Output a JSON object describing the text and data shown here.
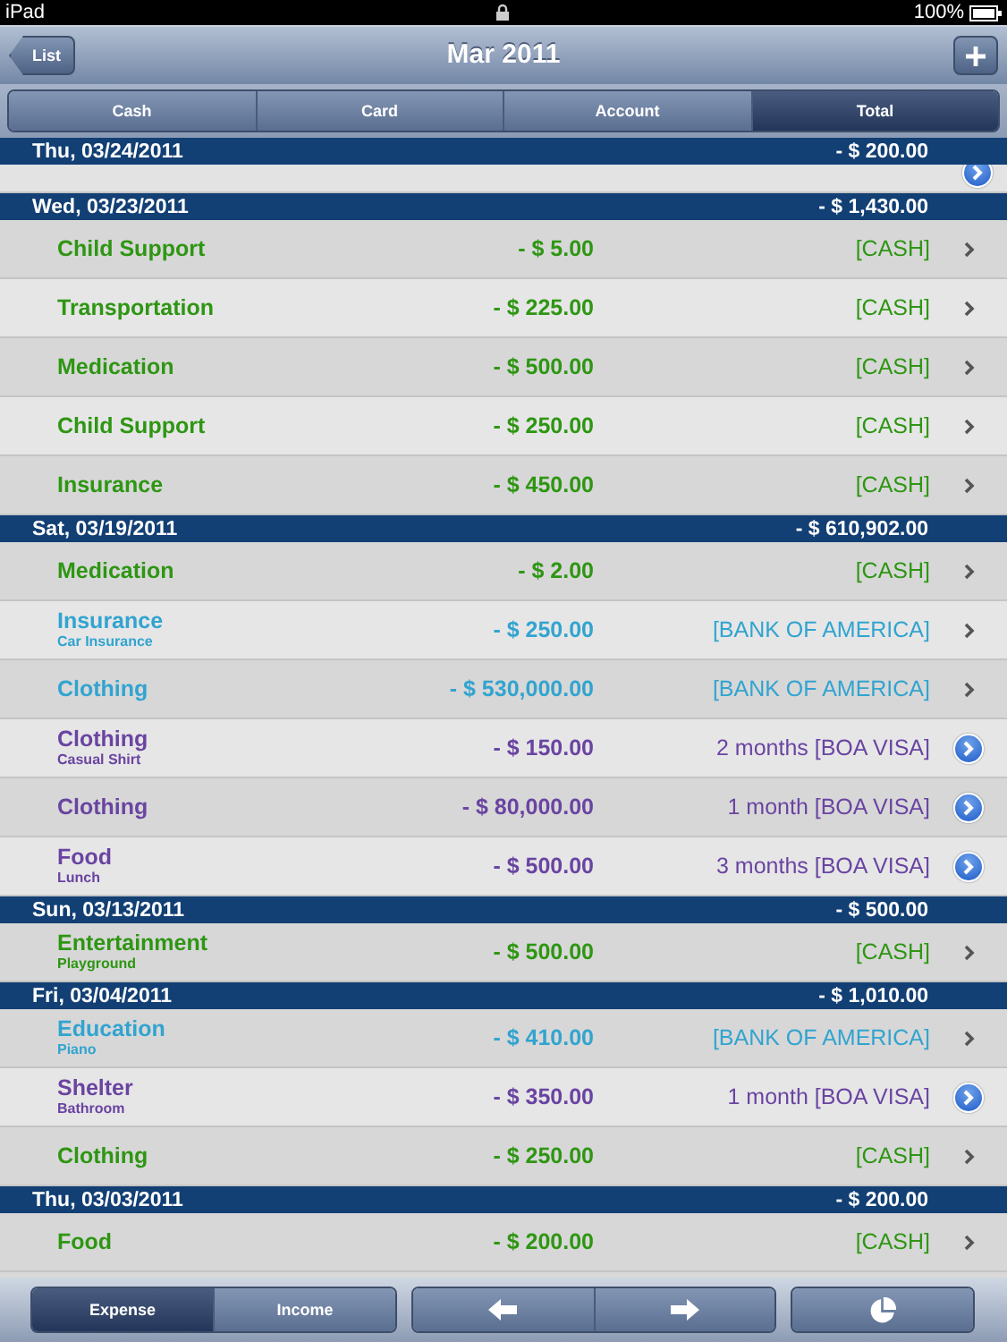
{
  "status_bar": {
    "device": "iPad",
    "battery": "100%"
  },
  "nav": {
    "back": "List",
    "title": "Mar 2011"
  },
  "segments": [
    {
      "label": "Cash",
      "selected": false
    },
    {
      "label": "Card",
      "selected": false
    },
    {
      "label": "Account",
      "selected": false
    },
    {
      "label": "Total",
      "selected": true
    }
  ],
  "groups": [
    {
      "date": "Thu, 03/24/2011",
      "total": "- $ 200.00",
      "partial": true
    },
    {
      "date": "Wed, 03/23/2011",
      "total": "- $ 1,430.00",
      "rows": [
        {
          "kind": "cash",
          "name": "Child Support",
          "amount": "- $ 5.00",
          "account": "[CASH]"
        },
        {
          "kind": "cash",
          "name": "Transportation",
          "amount": "- $ 225.00",
          "account": "[CASH]"
        },
        {
          "kind": "cash",
          "name": "Medication",
          "amount": "- $ 500.00",
          "account": "[CASH]"
        },
        {
          "kind": "cash",
          "name": "Child Support",
          "amount": "- $ 250.00",
          "account": "[CASH]"
        },
        {
          "kind": "cash",
          "name": "Insurance",
          "amount": "- $ 450.00",
          "account": "[CASH]"
        }
      ]
    },
    {
      "date": "Sat, 03/19/2011",
      "total": "- $ 610,902.00",
      "rows": [
        {
          "kind": "cash",
          "name": "Medication",
          "amount": "- $ 2.00",
          "account": "[CASH]"
        },
        {
          "kind": "bank",
          "name": "Insurance",
          "note": "Car Insurance",
          "amount": "- $ 250.00",
          "account": "[BANK OF AMERICA]"
        },
        {
          "kind": "bank",
          "name": "Clothing",
          "amount": "- $ 530,000.00",
          "account": "[BANK OF AMERICA]"
        },
        {
          "kind": "card",
          "name": "Clothing",
          "note": "Casual Shirt",
          "amount": "- $ 150.00",
          "account": "2 months [BOA VISA]"
        },
        {
          "kind": "card",
          "name": "Clothing",
          "amount": "- $ 80,000.00",
          "account": "1 month [BOA VISA]"
        },
        {
          "kind": "card",
          "name": "Food",
          "note": "Lunch",
          "amount": "- $ 500.00",
          "account": "3 months [BOA VISA]"
        }
      ]
    },
    {
      "date": "Sun, 03/13/2011",
      "total": "- $ 500.00",
      "rows": [
        {
          "kind": "cash",
          "name": "Entertainment",
          "note": "Playground",
          "amount": "- $ 500.00",
          "account": "[CASH]"
        }
      ]
    },
    {
      "date": "Fri, 03/04/2011",
      "total": "- $ 1,010.00",
      "rows": [
        {
          "kind": "bank",
          "name": "Education",
          "note": "Piano",
          "amount": "- $ 410.00",
          "account": "[BANK OF AMERICA]"
        },
        {
          "kind": "card",
          "name": "Shelter",
          "note": "Bathroom",
          "amount": "- $ 350.00",
          "account": "1 month [BOA VISA]"
        },
        {
          "kind": "cash",
          "name": "Clothing",
          "amount": "- $ 250.00",
          "account": "[CASH]"
        }
      ]
    },
    {
      "date": "Thu, 03/03/2011",
      "total": "- $ 200.00",
      "rows": [
        {
          "kind": "cash",
          "name": "Food",
          "amount": "- $ 200.00",
          "account": "[CASH]"
        }
      ]
    }
  ],
  "toolbar": {
    "modes": [
      {
        "label": "Expense",
        "selected": true
      },
      {
        "label": "Income",
        "selected": false
      }
    ]
  }
}
